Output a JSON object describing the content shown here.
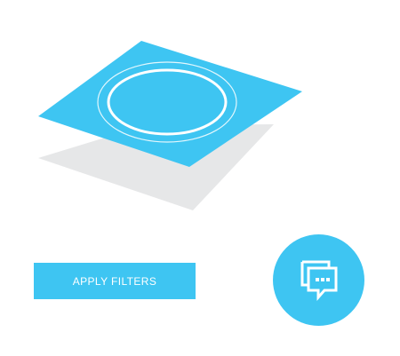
{
  "illustration": {
    "name": "layered-plane-illustration",
    "top_plane_color": "#3ec5f2",
    "shadow_plane_color": "#e6e7e8",
    "ring_color": "#ffffff"
  },
  "actions": {
    "apply_filters_label": "APPLY FILTERS"
  },
  "chat": {
    "icon": "chat-bubbles-icon"
  },
  "colors": {
    "accent": "#3ec5f2",
    "background": "#ffffff",
    "shadow": "#e6e7e8",
    "text_on_accent": "#ffffff"
  }
}
